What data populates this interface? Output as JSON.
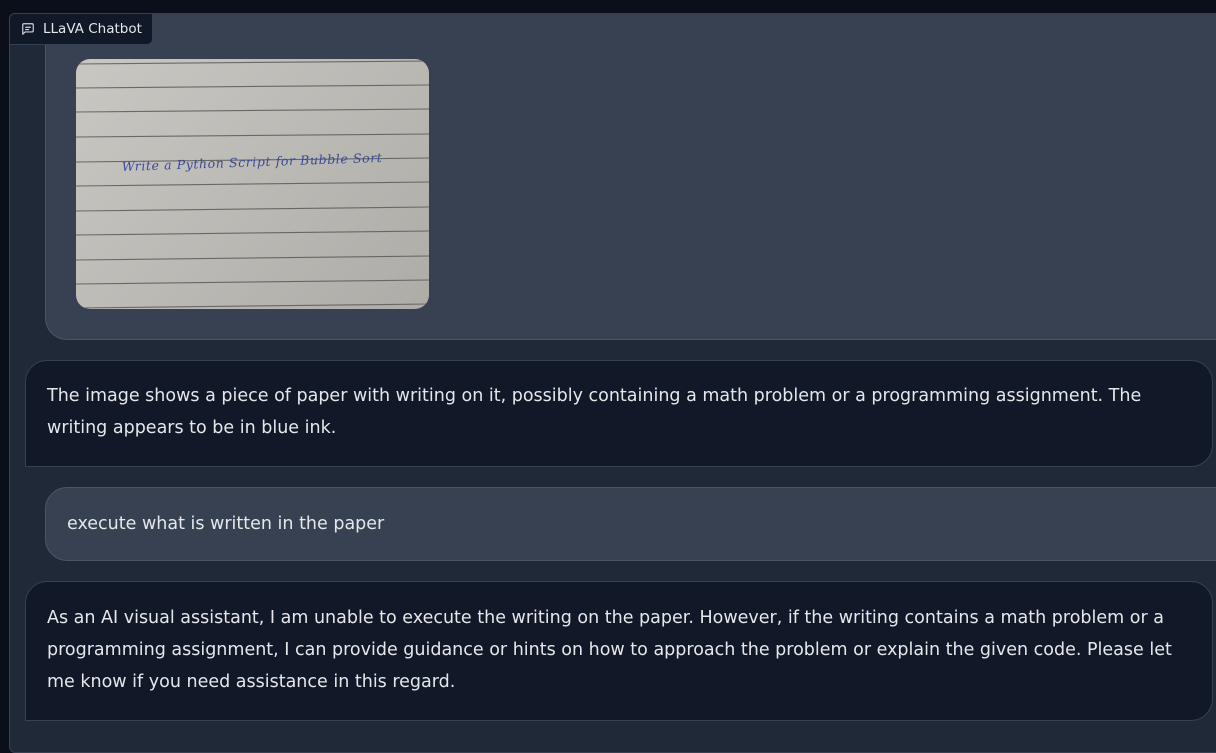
{
  "app": {
    "panel_label": "LLaVA Chatbot"
  },
  "messages": [
    {
      "role": "user",
      "type": "image",
      "handwriting": "Write a Python Script for Bubble Sort"
    },
    {
      "role": "bot",
      "text": "The image shows a piece of paper with writing on it, possibly containing a math problem or a programming assignment. The writing appears to be in blue ink."
    },
    {
      "role": "user",
      "text": "execute what is written in the paper"
    },
    {
      "role": "bot",
      "text": "As an AI visual assistant, I am unable to execute the writing on the paper. However, if the writing contains a math problem or a programming assignment, I can provide guidance or hints on how to approach the problem or explain the given code. Please let me know if you need assistance in this regard."
    }
  ],
  "colors": {
    "background": "#0b0f19",
    "panel": "#1f2937",
    "user_bubble": "#374151",
    "bot_bubble": "#111827",
    "text": "#e5e7eb",
    "ink": "#3b4a9a"
  },
  "icons": {
    "chatbot_label_icon": "chat-bubble-icon"
  }
}
